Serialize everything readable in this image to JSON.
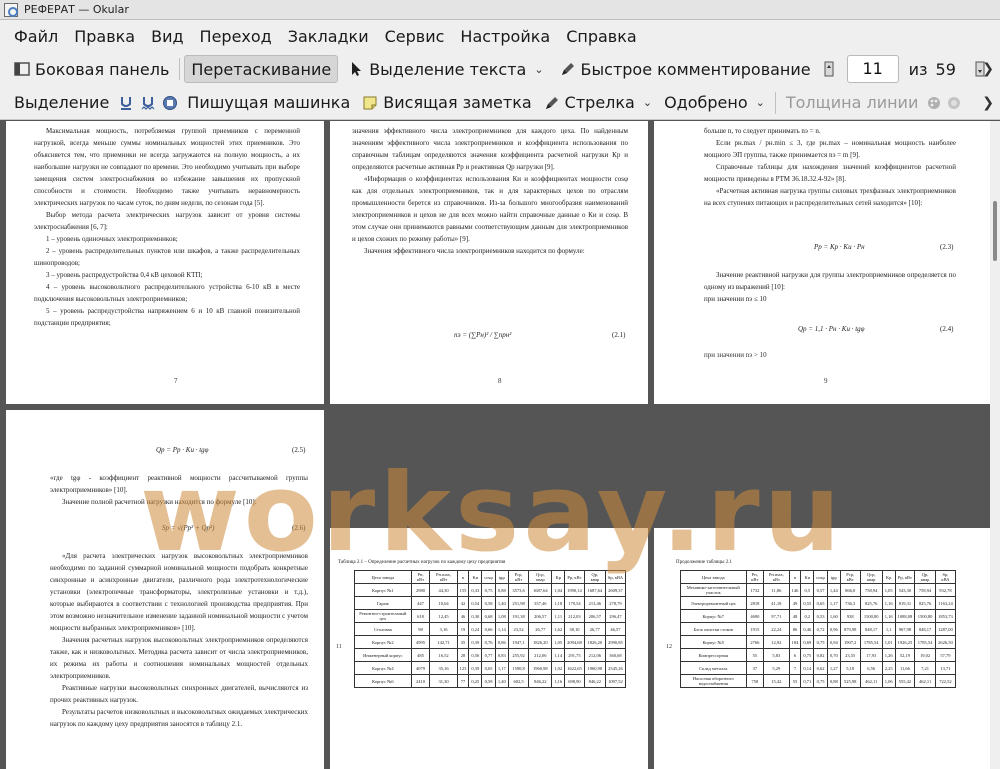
{
  "window": {
    "title": "РЕФЕРАТ  — Okular"
  },
  "menu": [
    "Файл",
    "Правка",
    "Вид",
    "Переход",
    "Закладки",
    "Сервис",
    "Настройка",
    "Справка"
  ],
  "toolbar1": {
    "sidebar": "Боковая панель",
    "drag": "Перетаскивание",
    "text_select": "Выделение текста",
    "quick_comment": "Быстрое комментирование",
    "page_current": "11",
    "page_of": "из",
    "page_total": "59"
  },
  "toolbar2": {
    "select": "Выделение",
    "typewriter": "Пишущая машинка",
    "sticky": "Висящая заметка",
    "arrow": "Стрелка",
    "approved": "Одобрено",
    "line_width": "Толщина линии"
  },
  "watermark": "worksay.ru",
  "page7": {
    "paras": [
      "Максимальная мощность, потребляемая группой приемников с переменной нагрузкой, всегда меньше суммы номинальных мощностей этих приемников. Это объясняется тем, что приемники не всегда загружаются на полную мощность, а их наибольшие нагрузки не совпадают по времени. Это необходимо учитывать при выборе замещения систем электроснабжения во избежание завышения их пропускной способности и стоимости. Необходимо также учитывать неравномерность электрических нагрузок по часам суток, по дням недели, по сезонам года [5].",
      "Выбор метода расчета электрических нагрузок зависит от уровня системы электроснабжения [6, 7]:",
      "1 – уровень одиночных электроприемников;",
      "2 – уровень распределительных пунктов или шкафов, а также распределительных шинопроводов;",
      "3 – уровень распредустройства 0,4 кВ цеховой КТП;",
      "4 – уровень высоковольтного распределительного устройства 6-10 кВ в месте подключения высоковольтных электроприемников;",
      "5 – уровень распредустройства напряжением 6 и 10 кВ главной понизительной подстанции предприятия;"
    ],
    "num": "7"
  },
  "page8": {
    "paras": [
      "значения эффективного числа электроприемников для каждого цеха. По найденным значениям эффективного числа электроприемников и коэффициента использования по справочным таблицам определяются значения коэффициента расчетной нагрузки Кр и определяются расчетные активная Рр и реактивная Qр нагрузки [9].",
      "«Информация о коэффициентах использования Ки и коэффициентах мощности cosφ как для отдельных электроприемников, так и для характерных цехов по отраслям промышленности берется из справочников. Из-за большого многообразия наименований электроприемников и цехов не для всех можно найти справочные данные о Ки и cosφ. В этом случае они принимаются равными соответствующим данным для электроприемников и цехов схожих по режиму работы» [9].",
      "Значения эффективного числа электроприемников находится по формуле:"
    ],
    "formula": "nэ = (∑Pн)² / ∑npн²",
    "eq": "(2.1)",
    "num": "8"
  },
  "page9": {
    "paras": [
      "больше n, то следует принимать nэ = n.",
      "Если pн.max / pн.min ≤ 3, где pн.max – номинальная мощность наиболее мощного ЭП группы, также принимается nэ = m [9].",
      "Справочные таблицы для нахождения значений коэффициентов расчетной мощности приведены в РТМ 36.18.32.4-92» [8].",
      "«Расчетная активная нагрузка группы силовых трехфазных электроприемников на всех ступенях питающих и распределительных сетей находится» [10]:"
    ],
    "formula1": "Pр = Kр · Kи · Pн",
    "eq1": "(2.3)",
    "paras2": [
      "Значение реактивной нагрузки для группы электроприемников определяется по одному из выражений [10]:",
      "при значении nэ ≤ 10"
    ],
    "formula2": "Qр = 1,1 · Pн · Kи · tgφ",
    "eq2": "(2.4)",
    "tail": "при значении nэ > 10",
    "num": "9"
  },
  "page10": {
    "formula1": "Qр = Pр · Kи · tgφ",
    "eq1": "(2.5)",
    "paras": [
      "«где tgφ - коэффициент реактивной мощности рассчитываемой группы электроприемников» [10].",
      "Значение полной расчетной нагрузки находится по формуле [10]:"
    ],
    "formula2": "Sр = √(Pр² + Qр²)",
    "eq2": "(2.6)",
    "paras2": [
      "«Для расчета электрических нагрузок высоковольтных электроприемников необходимо по заданной суммарной номинальной мощности подобрать конкретные синхронные и асинхронные двигатели, различного рода электротехнологические установки (электропечные трансформаторы, электролизные установки и т.д.), которые выбираются в соответствии с технологией производства предприятия. При этом возможно незначительное изменение заданной номинальной мощности с учетом мощности выбранных электроприемников» [10].",
      "Значения расчетных нагрузок высоковольтных электроприемников определяются также, как и низковольтных. Методика расчета зависит от числа электроприемников, их режима их работы и соотношения номинальных мощностей отдельных электроприемников.",
      "Реактивные нагрузки высоковольтных синхронных двигателей, вычисляются из прочих реактивных нагрузок.",
      "Результаты расчетов низковольтных и высоковольтных ожидаемых электрических нагрузок по каждому цеху предприятия заносятся в таблицу 2.1."
    ]
  },
  "page11": {
    "caption": "Таблица 2.1 – Определение расчетных нагрузок по каждому цеху предприятия",
    "num": "11",
    "headers": [
      "Цеха завода",
      "Pн, кВт",
      "Pн.max, кВт",
      "n",
      "Kи",
      "cosφ",
      "tgφ",
      "Pср, кВт",
      "Qср, квар",
      "Kр",
      "Pр, кВт",
      "Qр, квар",
      "Sр, кВА"
    ],
    "rows": [
      [
        "Корпус №1",
        "2980",
        "44,30",
        "155",
        "0,33",
        "0,75",
        "0,88",
        "3573,6",
        "1687,64",
        "1,04",
        "1990,14",
        "1687,64",
        "2609,37"
      ],
      [
        "Гараж",
        "447",
        "10,64",
        "42",
        "0,54",
        "0,58",
        "1,40",
        "251,98",
        "357,46",
        "1,18",
        "179,54",
        "213,46",
        "278,79"
      ],
      [
        "Ремонтно-строительный цех",
        "618",
        "12,45",
        "46",
        "0,30",
        "0,68",
        "1,08",
        "191,38",
        "206,57",
        "1,11",
        "212,03",
        "206,57",
        "296,47"
      ],
      [
        "Столовая",
        "98",
        "3,16",
        "19",
        "0,24",
        "0,66",
        "1,14",
        "23,52",
        "26,77",
        "1,62",
        "38,10",
        "26,77",
        "46,57"
      ],
      [
        "Корпус №2",
        "4995",
        "142,71",
        "35",
        "0,39",
        "0,76",
        "0,86",
        "1947,1",
        "1826,20",
        "1,05",
        "2094,68",
        "1826,20",
        "2990,85"
      ],
      [
        "Инженерный корпус",
        "485",
        "16,52",
        "28",
        "0,56",
        "0,77",
        "0,83",
        "255,92",
        "212,06",
        "1,14",
        "291,75",
        "212,06",
        "360,68"
      ],
      [
        "Корпус №4",
        "4079",
        "35,16",
        "123",
        "0,39",
        "0,65",
        "1,17",
        "1590,8",
        "1960,98",
        "1,02",
        "1622,65",
        "1960,98",
        "2545,26"
      ],
      [
        "Корпус №6",
        "2410",
        "31,30",
        "77",
        "0,25",
        "0,58",
        "1,40",
        "602,5",
        "846,22",
        "1,16",
        "698,90",
        "846,22",
        "1097,52"
      ]
    ]
  },
  "page12": {
    "caption": "Продолжение таблицы 2.1",
    "num": "12",
    "headers": [
      "Цеха завода",
      "Pн, кВт",
      "Pн.max, кВт",
      "n",
      "Kи",
      "cosφ",
      "tgφ",
      "Pср, кВт",
      "Qср, квар",
      "Kр",
      "Pр, кВт",
      "Qр, квар",
      "Sр, кВА"
    ],
    "rows": [
      [
        "Механико-заготовительный участок",
        "1732",
        "11,86",
        "146",
        "0,5",
        "0,57",
        "1,44",
        "866,0",
        "758,94",
        "1,05",
        "543,30",
        "758,94",
        "932,78"
      ],
      [
        "Электроремонтный цех",
        "2818",
        "41,18",
        "49",
        "0,55",
        "0,65",
        "1,17",
        "736,3",
        "825,76",
        "1,16",
        "819,31",
        "825,76",
        "1163,24"
      ],
      [
        "Корпус №7",
        "4690",
        "97,71",
        "48",
        "0,2",
        "0,53",
        "1,60",
        "938",
        "1500,80",
        "1,16",
        "1088,08",
        "1500,80",
        "1853,73"
      ],
      [
        "Блок очистки стоков",
        "1915",
        "22,24",
        "86",
        "0,46",
        "0,72",
        "0,96",
        "879,98",
        "848,17",
        "1,1",
        "967,98",
        "848,17",
        "1287,00"
      ],
      [
        "Корпус №5",
        "2766",
        "12,92",
        "184",
        "0,69",
        "0,75",
        "0,94",
        "1907,2",
        "1785,54",
        "1,01",
        "1926,25",
        "1785,54",
        "2626,50"
      ],
      [
        "Компрессорная",
        "55",
        "5,83",
        "6",
        "0,75",
        "0,82",
        "0,70",
        "23,55",
        "17,93",
        "1,26",
        "52,19",
        "19,02",
        "57,79"
      ],
      [
        "Склад металла",
        "37",
        "5,29",
        "7",
        "0,14",
        "0,62",
        "1,27",
        "5,18",
        "6,56",
        "2,25",
        "11,66",
        "7,21",
        "13,71"
      ],
      [
        "Насосная оборотного водоснабжения",
        "758",
        "15,42",
        "55",
        "0,71",
        "0,75",
        "0,88",
        "525,98",
        "462,11",
        "1,06",
        "555,42",
        "462,11",
        "722,52"
      ]
    ]
  }
}
